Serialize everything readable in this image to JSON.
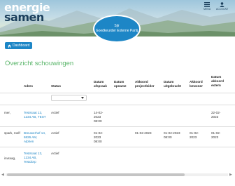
{
  "brand": {
    "line1": "energie",
    "line2": "samen"
  },
  "topnav": {
    "menu_label": "MENU",
    "account_label": "ACCOUNT"
  },
  "badge": {
    "line1": "Sjir",
    "line2": "Goedkeurder Externe Partij"
  },
  "dashboard_button": {
    "label": "Dashboard",
    "icon": "home-icon"
  },
  "page_title": "Overzicht schouwingen",
  "table": {
    "columns": [
      "Adres",
      "Status",
      "Datum afspraak",
      "Datum opname",
      "Akkoord projectleider",
      "Datum uitgebracht",
      "Akkoord bewoner",
      "Datum akkoord extern"
    ],
    "status_filter_value": "",
    "rows": [
      {
        "name": "mer,",
        "adres": "Testsraat 13, 1234 AB, TEST",
        "status": "Actief",
        "datum_afspraak": "14-02-2023 08:00",
        "datum_opname": "",
        "akkoord_projectleider": "",
        "datum_uitgebracht": "",
        "akkoord_bewoner": "",
        "datum_akkoord_extern": "22-02-2023"
      },
      {
        "name": "spark, roelf",
        "adres": "Breuwerhof 14, 6826 AM, Alphen",
        "status": "Actief",
        "datum_afspraak": "01-02-2023 08:00",
        "datum_opname": "",
        "akkoord_projectleider": "01-02-2023",
        "datum_uitgebracht": "01-02-2023 08:00",
        "akkoord_bewoner": "01-02-2023",
        "datum_akkoord_extern": "01-02-2023"
      },
      {
        "name": "invraag,",
        "adres": "Testsraat 13, 1234 AB, Testdorp",
        "status": "Actief",
        "datum_afspraak": "",
        "datum_opname": "",
        "akkoord_projectleider": "",
        "datum_uitgebracht": "",
        "akkoord_bewoner": "",
        "datum_akkoord_extern": ""
      }
    ]
  },
  "colors": {
    "primary": "#1d86c6",
    "title_green": "#5ab56a",
    "brand_dark": "#1b3f5c"
  }
}
